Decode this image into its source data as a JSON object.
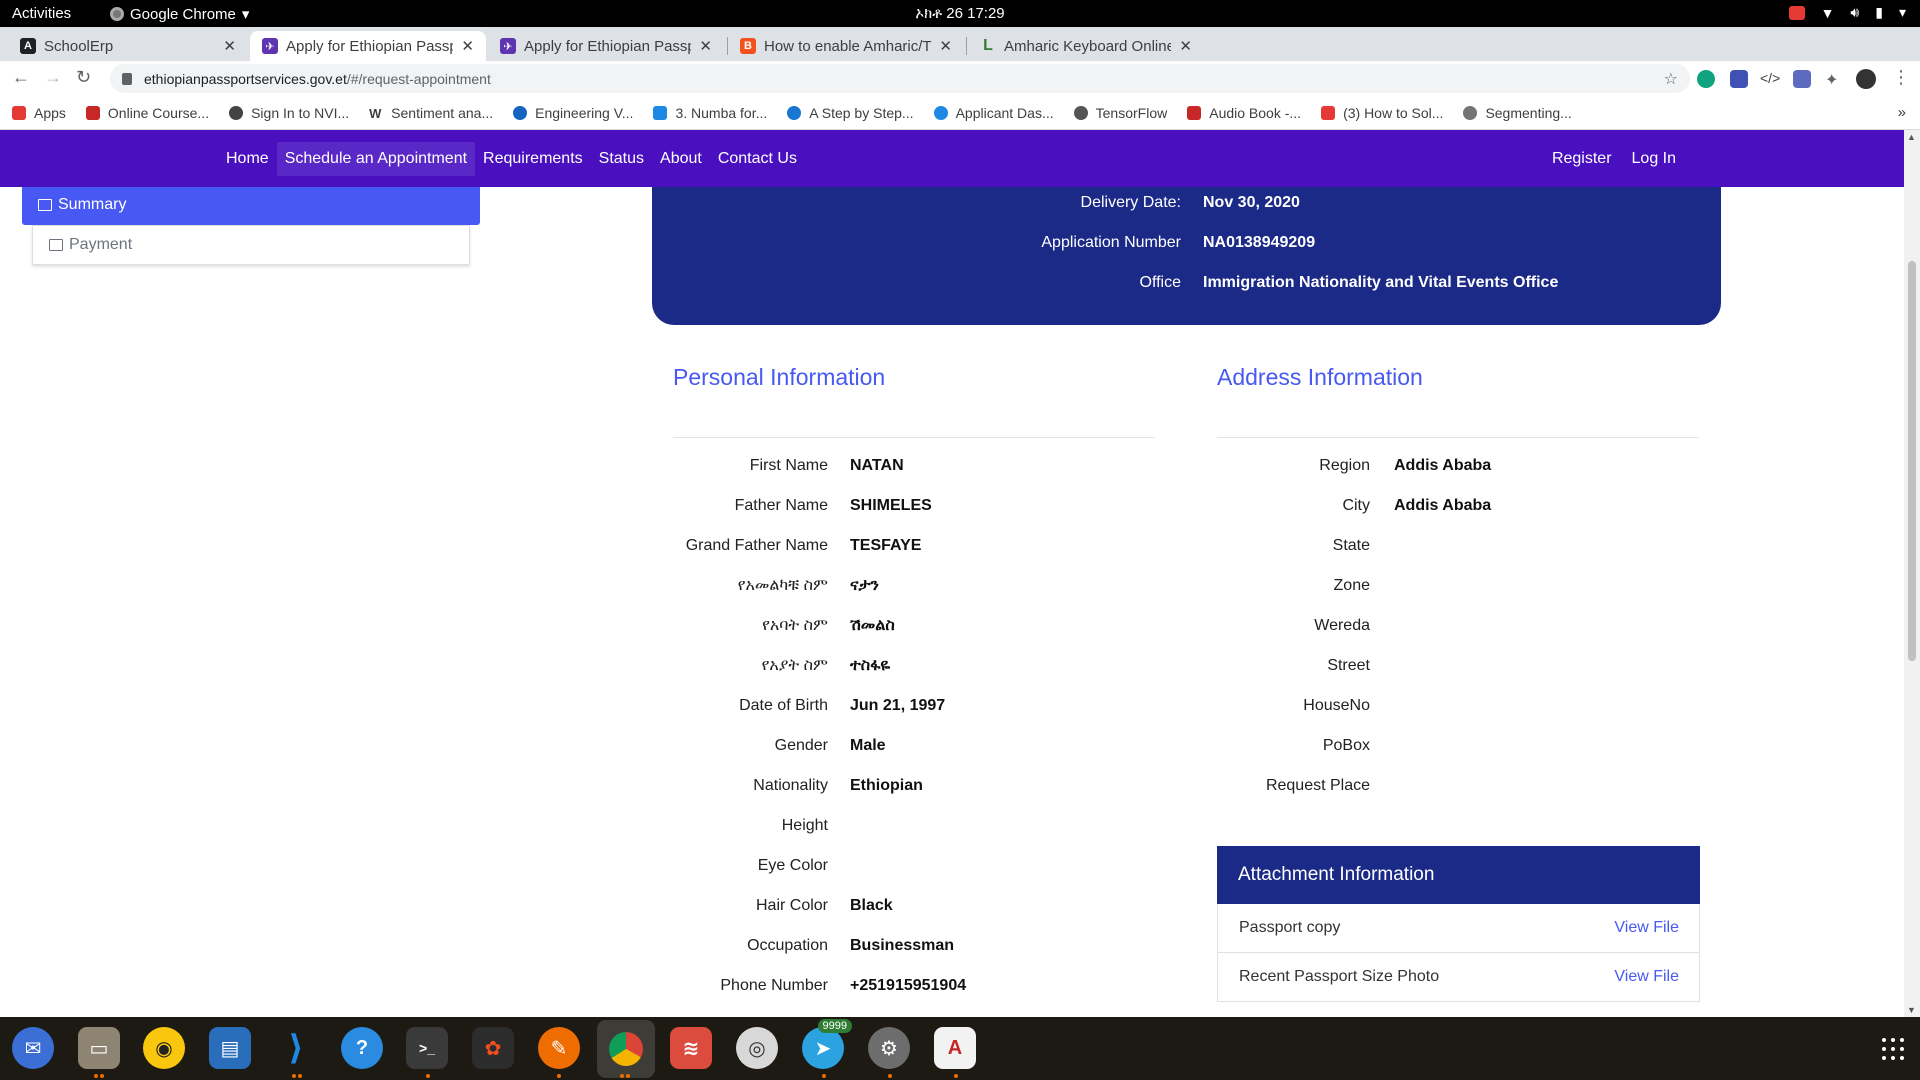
{
  "system_bar": {
    "activities": "Activities",
    "app_name": "Google Chrome",
    "clock": "ኦክቶ 26  17:29"
  },
  "tabs": [
    {
      "title": "SchoolErp",
      "icon": "schoolerp-icon",
      "active": false
    },
    {
      "title": "Apply for Ethiopian Passp",
      "icon": "passport-site-icon",
      "active": true
    },
    {
      "title": "Apply for Ethiopian Passp",
      "icon": "passport-site-icon",
      "active": false
    },
    {
      "title": "How to enable Amharic/T",
      "icon": "blogger-icon",
      "active": false
    },
    {
      "title": "Amharic Keyboard Online",
      "icon": "lexilogos-icon",
      "active": false
    }
  ],
  "omnibox": {
    "host": "ethiopianpassportservices.gov.et",
    "path": "/#/request-appointment"
  },
  "bookmarks": [
    {
      "label": "Apps",
      "color": "#e53935"
    },
    {
      "label": "Online Course...",
      "color": "#c62828"
    },
    {
      "label": "Sign In to NVI...",
      "color": "#444444"
    },
    {
      "label": "Sentiment ana...",
      "color": "#000000"
    },
    {
      "label": "Engineering V...",
      "color": "#1565c0"
    },
    {
      "label": "3. Numba for...",
      "color": "#1e88e5"
    },
    {
      "label": "A Step by Step...",
      "color": "#1976d2"
    },
    {
      "label": "Applicant Das...",
      "color": "#1e88e5"
    },
    {
      "label": "TensorFlow",
      "color": "#555555"
    },
    {
      "label": "Audio Book -...",
      "color": "#c62828"
    },
    {
      "label": "(3) How to Sol...",
      "color": "#e53935"
    },
    {
      "label": "Segmenting...",
      "color": "#757575"
    }
  ],
  "site_nav": {
    "links": [
      "Home",
      "Schedule an Appointment",
      "Requirements",
      "Status",
      "About",
      "Contact Us"
    ],
    "active": "Schedule an Appointment",
    "register": "Register",
    "login": "Log In"
  },
  "side_menu": {
    "summary": "Summary",
    "payment": "Payment"
  },
  "banner": {
    "delivery_date_label": "Delivery Date:",
    "delivery_date": "Nov 30, 2020",
    "application_number_label": "Application Number",
    "application_number": "NA0138949209",
    "office_label": "Office",
    "office": "Immigration Nationality and Vital Events Office"
  },
  "personal": {
    "title": "Personal Information",
    "fields": [
      {
        "label": "First Name",
        "value": "NATAN"
      },
      {
        "label": "Father Name",
        "value": "SHIMELES"
      },
      {
        "label": "Grand Father Name",
        "value": "TESFAYE"
      },
      {
        "label": "የአመልካቹ ስም",
        "value": "ናታን"
      },
      {
        "label": "የአባት ስም",
        "value": "ሽመልስ"
      },
      {
        "label": "የአያት ስም",
        "value": "ተስፋዬ"
      },
      {
        "label": "Date of Birth",
        "value": "Jun 21, 1997"
      },
      {
        "label": "Gender",
        "value": "Male"
      },
      {
        "label": "Nationality",
        "value": "Ethiopian"
      },
      {
        "label": "Height",
        "value": ""
      },
      {
        "label": "Eye Color",
        "value": ""
      },
      {
        "label": "Hair Color",
        "value": "Black"
      },
      {
        "label": "Occupation",
        "value": "Businessman"
      },
      {
        "label": "Phone Number",
        "value": "+251915951904"
      }
    ]
  },
  "address": {
    "title": "Address Information",
    "fields": [
      {
        "label": "Region",
        "value": "Addis Ababa"
      },
      {
        "label": "City",
        "value": "Addis Ababa"
      },
      {
        "label": "State",
        "value": ""
      },
      {
        "label": "Zone",
        "value": ""
      },
      {
        "label": "Wereda",
        "value": ""
      },
      {
        "label": "Street",
        "value": ""
      },
      {
        "label": "HouseNo",
        "value": ""
      },
      {
        "label": "PoBox",
        "value": ""
      },
      {
        "label": "Request Place",
        "value": ""
      }
    ]
  },
  "attachments": {
    "title": "Attachment Information",
    "rows": [
      {
        "name": "Passport copy",
        "link": "View File"
      },
      {
        "name": "Recent Passport Size Photo",
        "link": "View File"
      }
    ]
  },
  "dock": {
    "telegram_badge": "9999",
    "apps": [
      "thunderbird-icon",
      "files-icon",
      "rhythmbox-icon",
      "writer-icon",
      "vscode-icon",
      "help-icon",
      "terminal-icon",
      "figma-icon",
      "postman-icon",
      "chrome-icon",
      "todoist-icon",
      "disks-icon",
      "telegram-icon",
      "settings-icon",
      "font-viewer-icon"
    ]
  },
  "colors": {
    "navbar": "#4a0fbf",
    "banner": "#1c2a87",
    "accent": "#4759f2"
  }
}
